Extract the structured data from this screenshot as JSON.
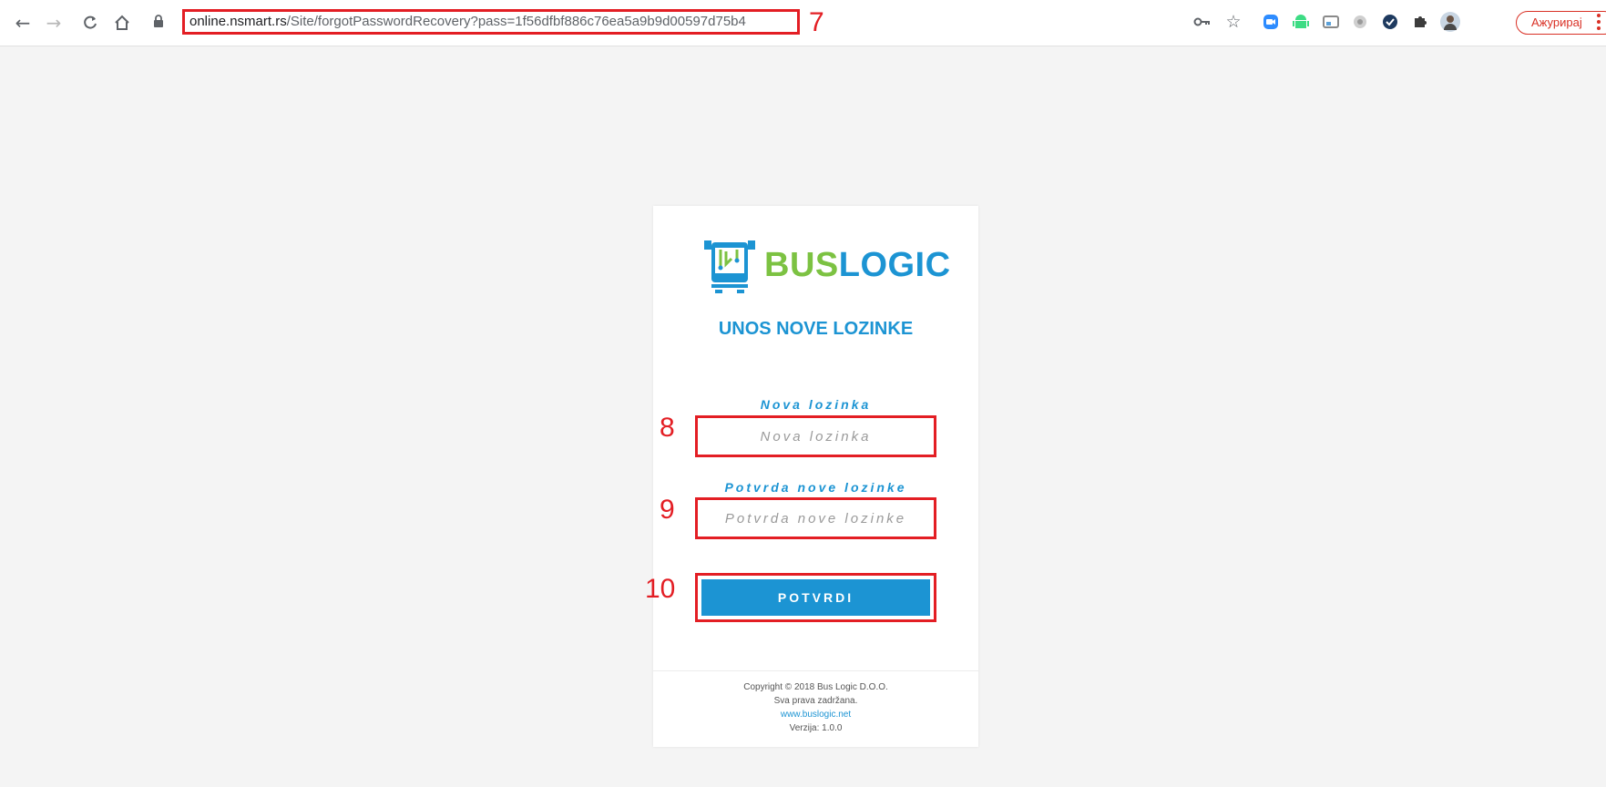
{
  "browser": {
    "url_host": "online.nsmart.rs",
    "url_path": "/Site/forgotPasswordRecovery?pass=1f56dfbf886c76ea5a9b9d00597d75b4",
    "update_label": "Ажурирај",
    "icons": [
      "back-icon",
      "forward-icon",
      "reload-icon",
      "home-icon",
      "lock-icon",
      "key-icon",
      "star-icon",
      "zoom-icon",
      "android-icon",
      "cast-icon",
      "extension-circle-icon",
      "check-circle-icon",
      "puzzle-icon",
      "profile-avatar",
      "menu-icon"
    ]
  },
  "annotations": {
    "url": "7",
    "new_password": "8",
    "confirm_password": "9",
    "submit": "10"
  },
  "card": {
    "logo_text_part1": "BUS",
    "logo_text_part2": "LOGIC",
    "title": "UNOS NOVE LOZINKE",
    "new_password_label": "Nova lozinka",
    "new_password_placeholder": "Nova lozinka",
    "confirm_password_label": "Potvrda nove lozinke",
    "confirm_password_placeholder": "Potvrda nove lozinke",
    "submit_label": "POTVRDI",
    "footer": {
      "copyright": "Copyright © 2018 Bus Logic D.O.O.",
      "rights": "Sva prava zadržana.",
      "website": "www.buslogic.net",
      "version": "Verzija: 1.0.0"
    }
  },
  "colors": {
    "brand_blue": "#1c94d3",
    "brand_green": "#7cc242",
    "annotation_red": "#e31e24",
    "page_bg": "#f4f4f4"
  }
}
